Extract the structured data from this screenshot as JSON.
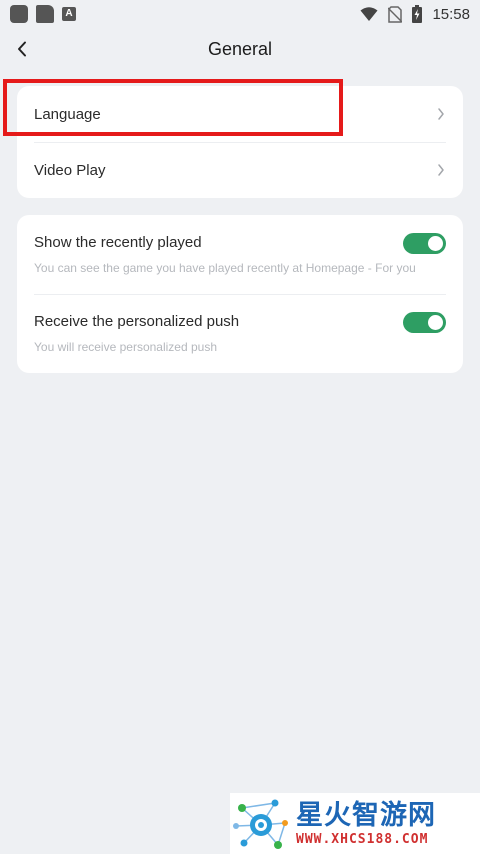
{
  "status_bar": {
    "time": "15:58",
    "app_icons": [
      "app-icon",
      "clipboard-icon",
      "keyboard-a-icon"
    ],
    "a_icon_letter": "A",
    "status_icons": [
      "wifi-icon",
      "no-sim-icon",
      "battery-charging-icon"
    ]
  },
  "header": {
    "title": "General",
    "back_icon": "chevron-left-icon"
  },
  "card1": {
    "items": [
      {
        "label": "Language",
        "icon": "chevron-right-icon"
      },
      {
        "label": "Video Play",
        "icon": "chevron-right-icon"
      }
    ]
  },
  "card2": {
    "toggles": [
      {
        "title": "Show the recently played",
        "subtitle": "You can see the game you have played recently at Homepage - For you",
        "on": true
      },
      {
        "title": "Receive the personalized push",
        "subtitle": "You will receive personalized push",
        "on": true
      }
    ]
  },
  "colors": {
    "background": "#eef0f3",
    "card": "#ffffff",
    "toggle_on": "#2e9e63",
    "highlight": "#e51a1a",
    "subtitle": "#b5b8bd"
  },
  "watermark": {
    "title": "星火智游网",
    "url": "WWW.XHCS188.COM"
  }
}
